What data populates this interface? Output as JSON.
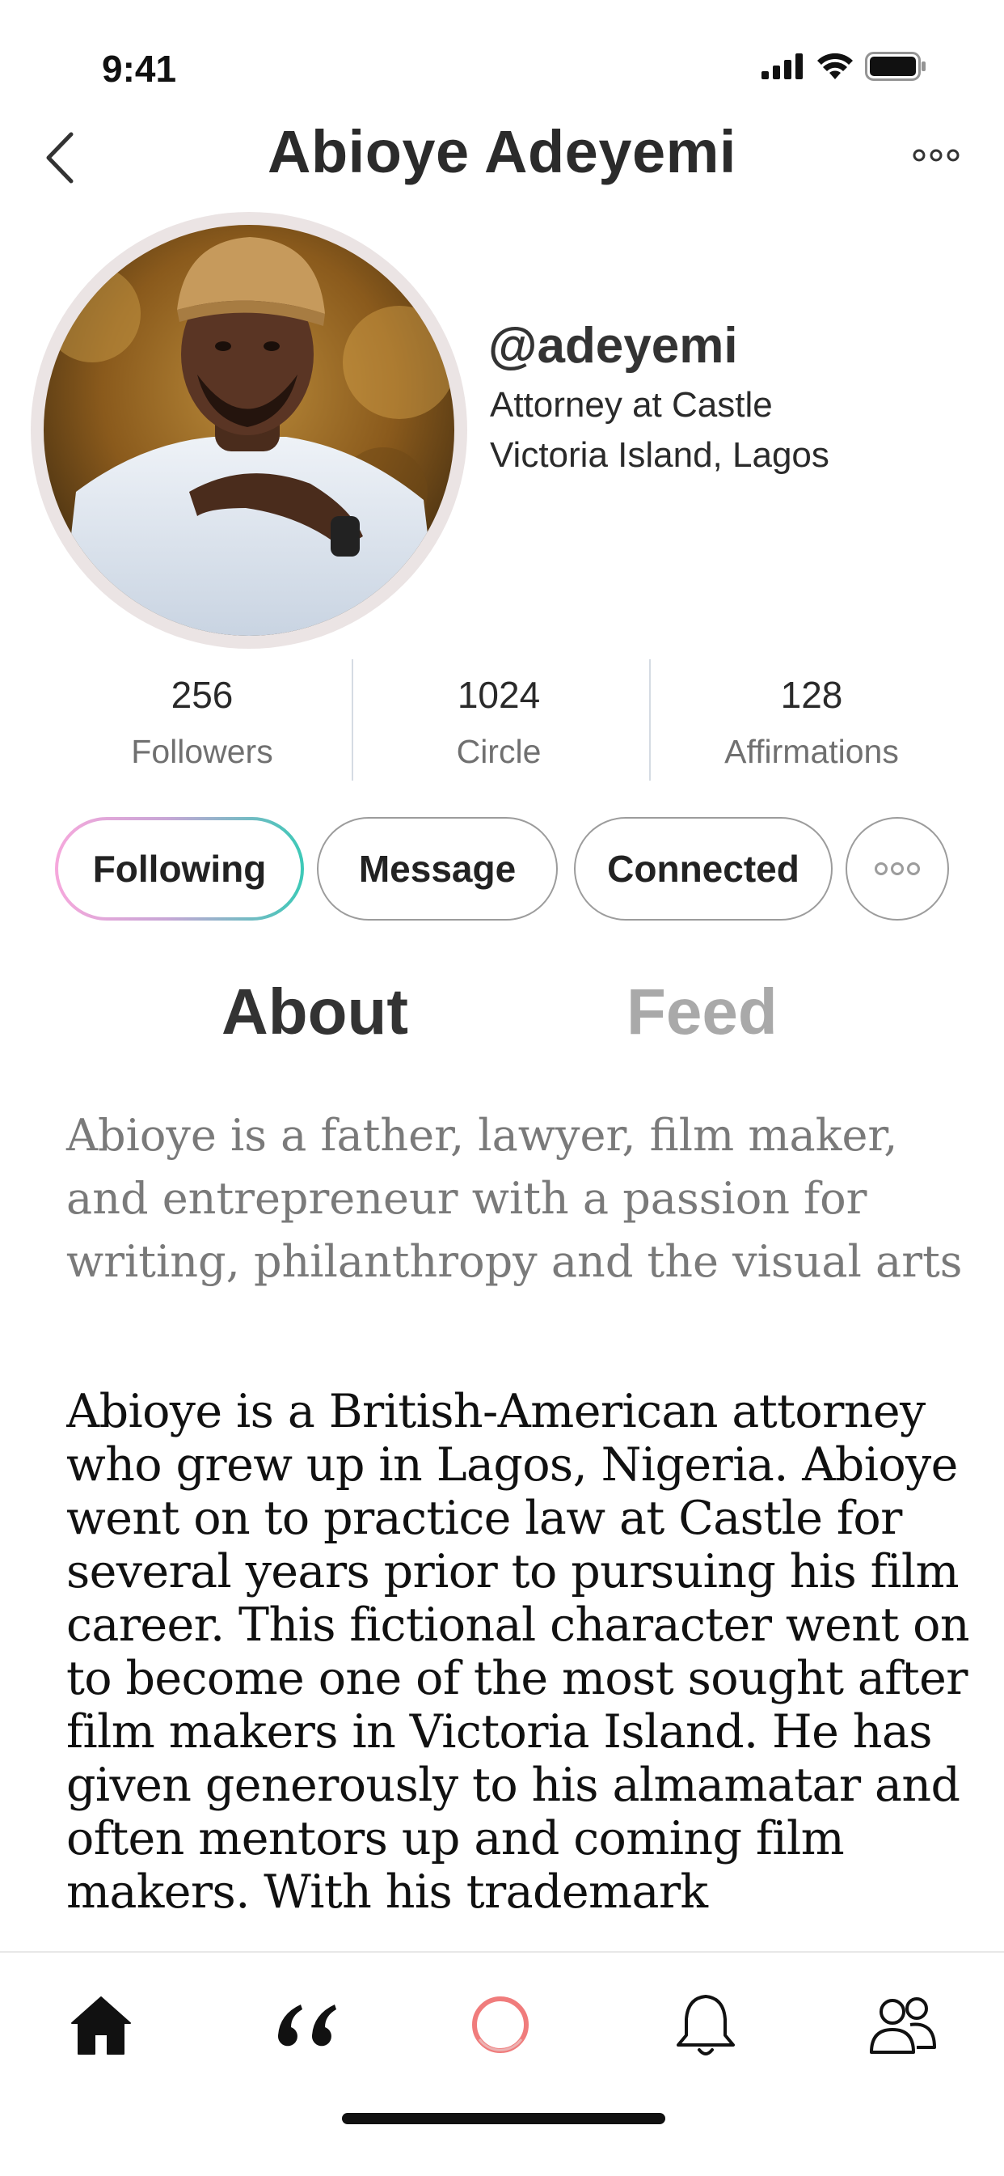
{
  "status_bar": {
    "time": "9:41"
  },
  "header": {
    "title": "Abioye Adeyemi"
  },
  "profile": {
    "handle": "@adeyemi",
    "role": "Attorney at Castle",
    "location": "Victoria Island, Lagos"
  },
  "stats": [
    {
      "value": "256",
      "label": "Followers"
    },
    {
      "value": "1024",
      "label": "Circle"
    },
    {
      "value": "128",
      "label": "Affirmations"
    }
  ],
  "actions": {
    "following": "Following",
    "message": "Message",
    "connected": "Connected"
  },
  "tabs": {
    "about": "About",
    "feed": "Feed",
    "active": "About"
  },
  "bio": {
    "summary": "Abioye is a father, lawyer, film maker, and entrepreneur with a passion for writing, philanthropy and the visual arts",
    "body": "Abioye is a British-American attorney who  grew up in Lagos, Nigeria. Abioye went on to practice law at Castle for several years prior to pursuing his film career. This fictional character went on to become one of the most sought after film makers in Victoria Island. He has given generously to his almamatar and often mentors up and coming film makers. With his trademark"
  },
  "bottom_nav": {
    "items": [
      "home-icon",
      "quote-icon",
      "record-icon",
      "bell-icon",
      "people-icon"
    ],
    "active": "home-icon"
  },
  "colors": {
    "following_gradient": [
      "#f6a8dc",
      "#3cc9b7"
    ],
    "record_ring": "#f07c7c",
    "inactive_tab": "#a9a9a9"
  }
}
